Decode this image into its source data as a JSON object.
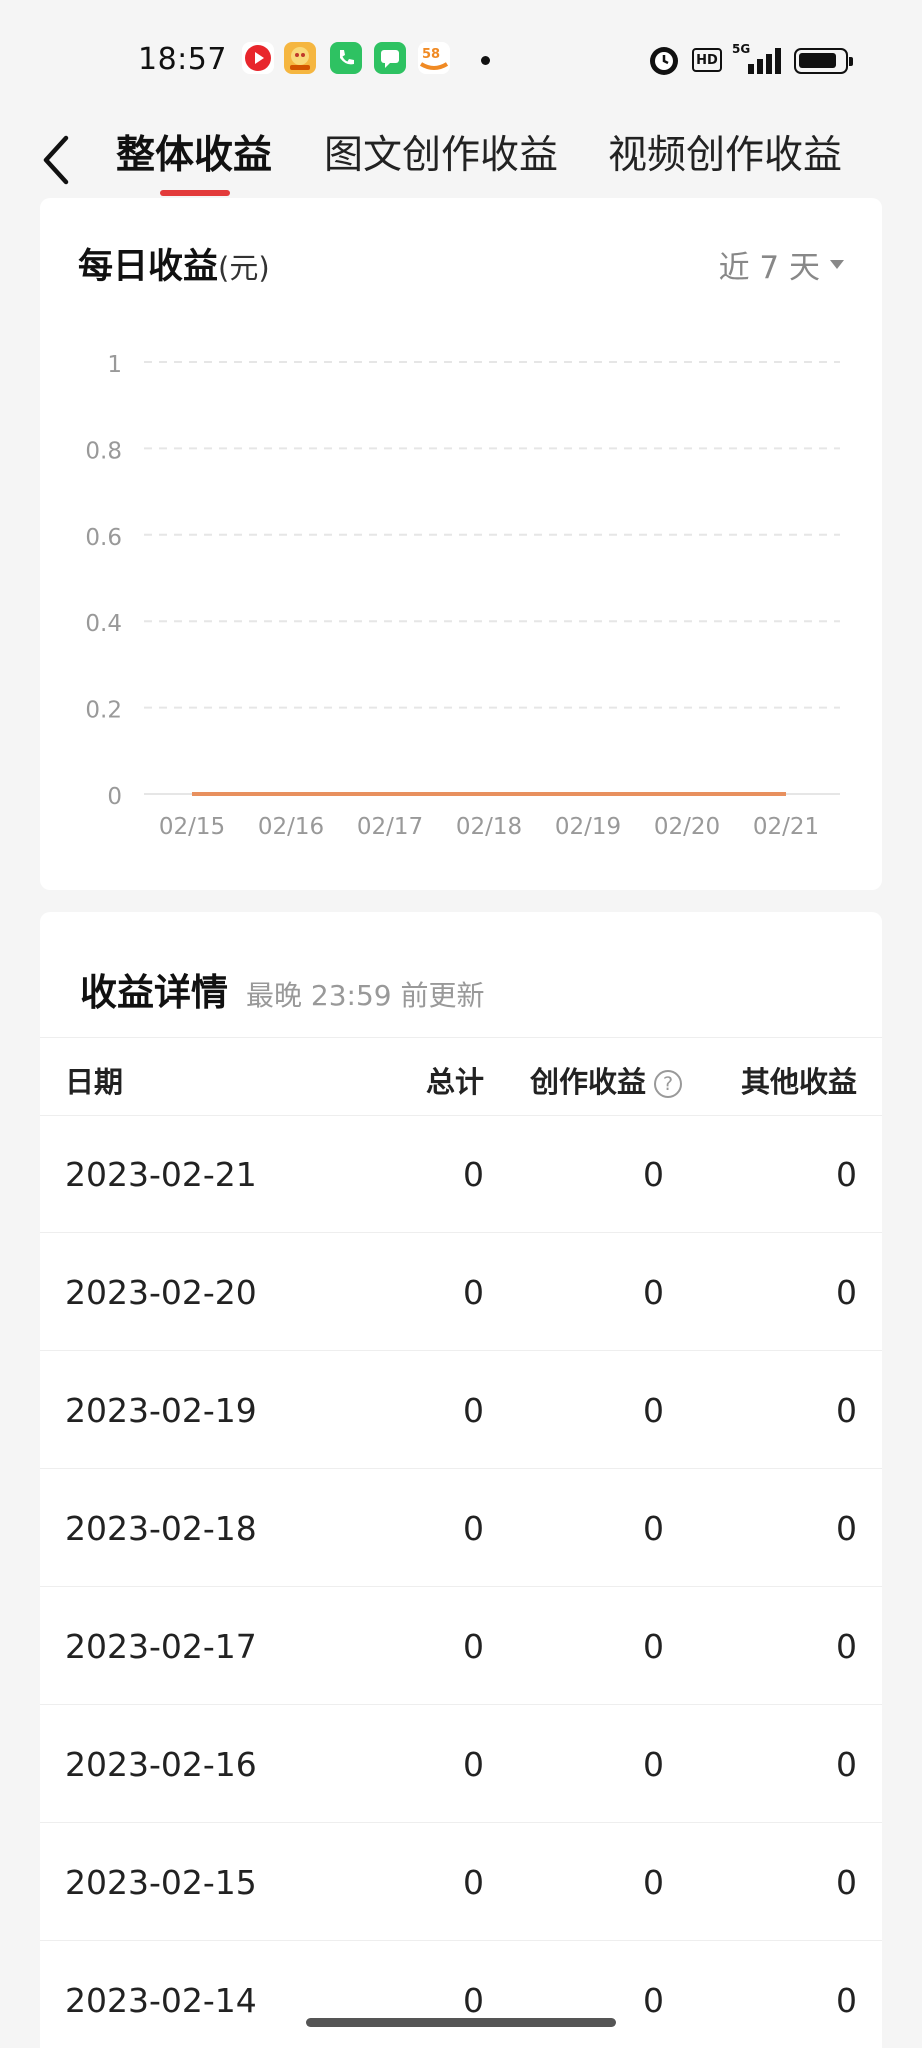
{
  "status_bar": {
    "time": "18:57",
    "hd_label": "HD",
    "network_label": "5G",
    "battery_level": 0.85,
    "notification_icons": [
      "video-app-icon",
      "game-app-icon",
      "phone-icon",
      "message-icon",
      "58-app-icon"
    ]
  },
  "nav": {
    "tabs": [
      {
        "label": "整体收益"
      },
      {
        "label": "图文创作收益"
      },
      {
        "label": "视频创作收益"
      }
    ],
    "accent_color": "#e33b3b"
  },
  "chart_card": {
    "title": "每日收益",
    "unit": "(元)",
    "range_label": "近 7 天"
  },
  "chart_data": {
    "type": "line",
    "categories": [
      "02/15",
      "02/16",
      "02/17",
      "02/18",
      "02/19",
      "02/20",
      "02/21"
    ],
    "series": [
      {
        "values": [
          0,
          0,
          0,
          0,
          0,
          0,
          0
        ],
        "color": "#e8905e"
      }
    ],
    "ylim": [
      0,
      1
    ],
    "yticks": [
      "0",
      "0.2",
      "0.4",
      "0.6",
      "0.8",
      "1"
    ],
    "grid": true
  },
  "detail": {
    "title": "收益详情",
    "subtitle": "最晚 23:59 前更新",
    "columns": [
      "日期",
      "总计",
      "创作收益",
      "其他收益"
    ],
    "rows": [
      [
        "2023-02-21",
        "0",
        "0",
        "0"
      ],
      [
        "2023-02-20",
        "0",
        "0",
        "0"
      ],
      [
        "2023-02-19",
        "0",
        "0",
        "0"
      ],
      [
        "2023-02-18",
        "0",
        "0",
        "0"
      ],
      [
        "2023-02-17",
        "0",
        "0",
        "0"
      ],
      [
        "2023-02-16",
        "0",
        "0",
        "0"
      ],
      [
        "2023-02-15",
        "0",
        "0",
        "0"
      ],
      [
        "2023-02-14",
        "0",
        "0",
        "0"
      ]
    ]
  }
}
